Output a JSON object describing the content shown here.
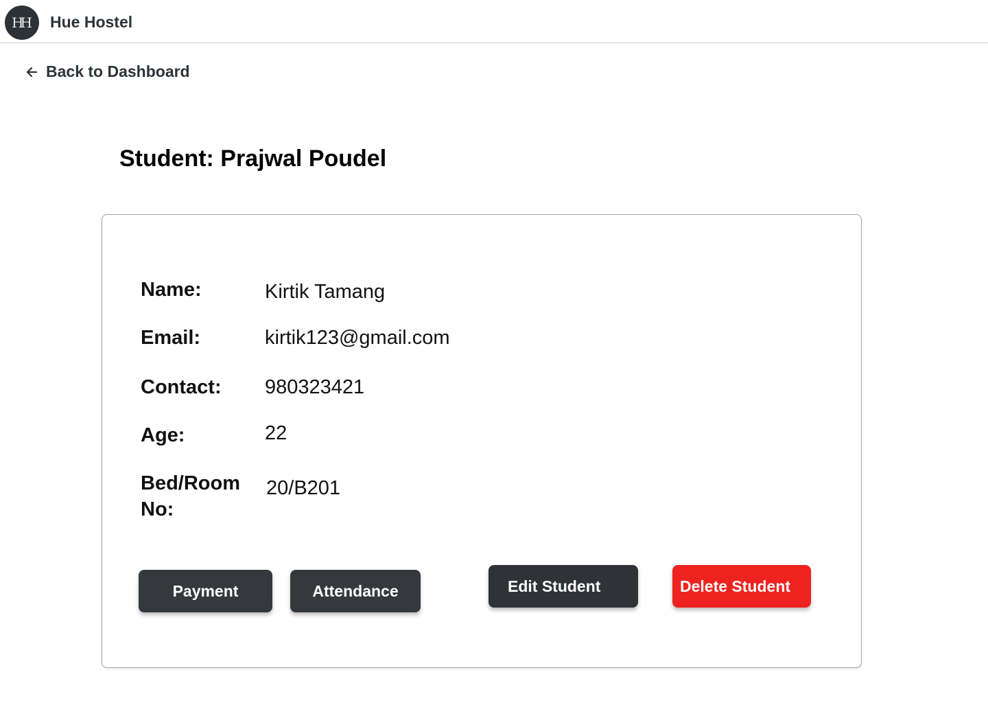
{
  "header": {
    "logo_text": "HH",
    "app_title": "Hue Hostel"
  },
  "nav": {
    "back_label": "Back to Dashboard"
  },
  "page": {
    "title": "Student: Prajwal Poudel"
  },
  "details": {
    "name_label": "Name:",
    "name_value": "Kirtik Tamang",
    "email_label": "Email:",
    "email_value": "kirtik123@gmail.com",
    "contact_label": "Contact:",
    "contact_value": "980323421",
    "age_label": "Age:",
    "age_value": "22",
    "bed_label": "Bed/Room No:",
    "bed_value": "20/B201"
  },
  "actions": {
    "payment_label": "Payment",
    "attendance_label": "Attendance",
    "edit_label": "Edit Student",
    "delete_label": "Delete Student"
  },
  "colors": {
    "primary_button": "#35383d",
    "danger_button": "#ee231f",
    "logo_bg": "#2d3237"
  },
  "icons": {
    "back": "arrow-left-icon"
  }
}
